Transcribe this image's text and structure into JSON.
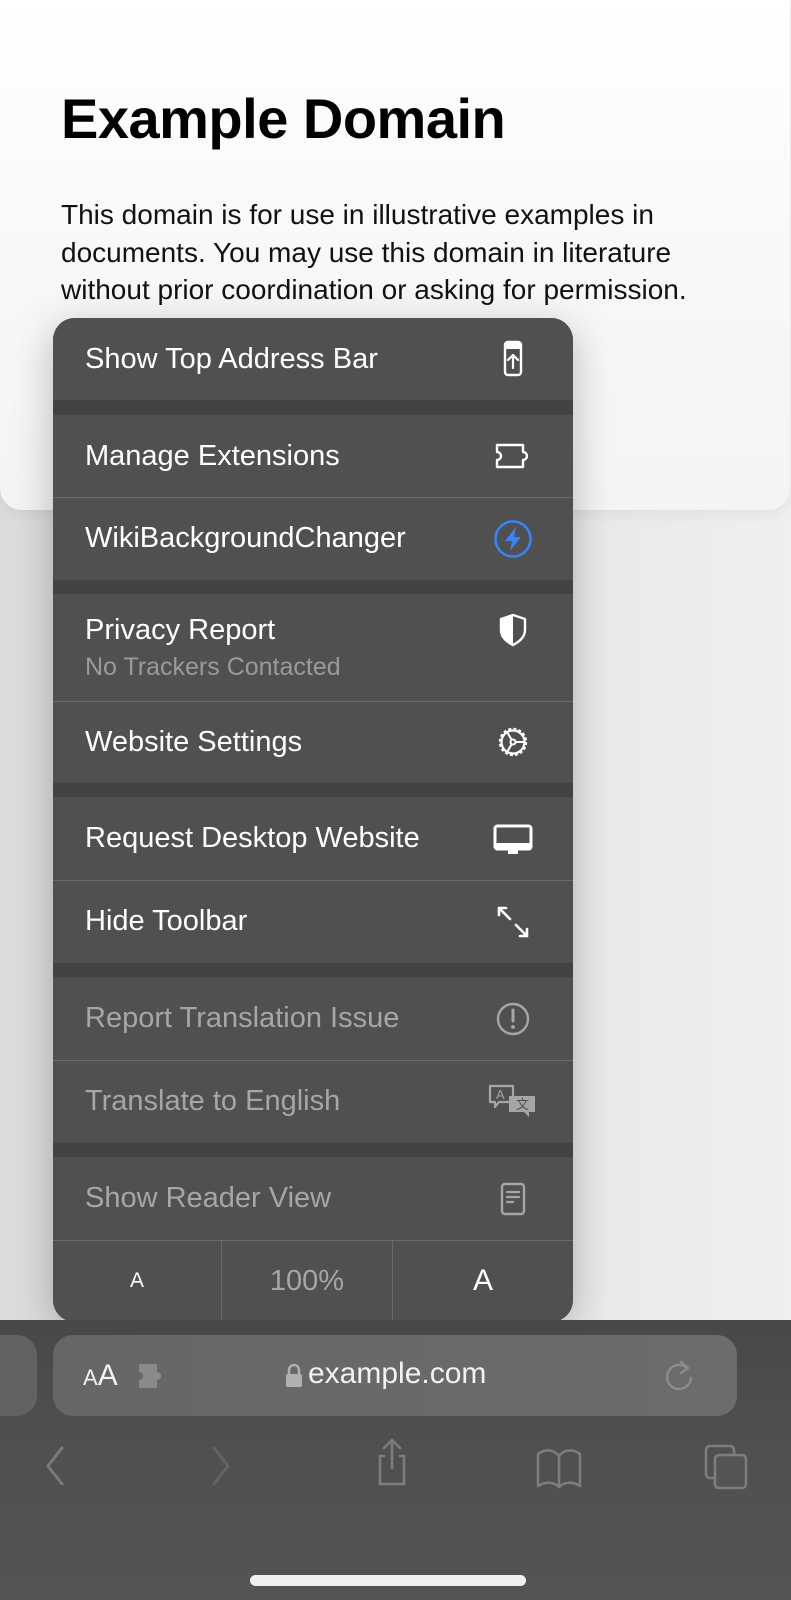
{
  "page": {
    "title": "Example Domain",
    "paragraph": "This domain is for use in illustrative examples in documents. You may use this domain in literature without prior coordination or asking for permission."
  },
  "menu": {
    "items": [
      {
        "label": "Show Top Address Bar",
        "icon": "phone-address-bar-up-icon",
        "enabled": true
      },
      {
        "label": "Manage Extensions",
        "icon": "puzzle-piece-icon",
        "enabled": true
      },
      {
        "label": "WikiBackgroundChanger",
        "icon": "lightning-bolt-circle-icon",
        "enabled": true,
        "icon_color": "#3a82f7"
      },
      {
        "label": "Privacy Report",
        "sublabel": "No Trackers Contacted",
        "icon": "half-shield-icon",
        "enabled": true
      },
      {
        "label": "Website Settings",
        "icon": "gear-icon",
        "enabled": true
      },
      {
        "label": "Request Desktop Website",
        "icon": "desktop-monitor-icon",
        "enabled": true
      },
      {
        "label": "Hide Toolbar",
        "icon": "expand-arrows-icon",
        "enabled": true
      },
      {
        "label": "Report Translation Issue",
        "icon": "exclamation-circle-icon",
        "enabled": false
      },
      {
        "label": "Translate to English",
        "icon": "translate-bubbles-icon",
        "enabled": false
      },
      {
        "label": "Show Reader View",
        "icon": "reader-doc-icon",
        "enabled": false
      }
    ],
    "font_size": {
      "decrease_label": "A",
      "zoom_level": "100%",
      "increase_label": "A"
    }
  },
  "toolbar": {
    "aa_small": "A",
    "aa_large": "A",
    "url": "example.com",
    "nav": [
      "back-icon",
      "forward-icon",
      "share-icon",
      "bookmarks-icon",
      "tabs-icon"
    ]
  },
  "colors": {
    "menu_bg": "#505050",
    "menu_group_gap": "#434343",
    "text_enabled": "#ffffff",
    "text_disabled": "#a6a6a6",
    "accent_blue": "#3a82f7"
  }
}
